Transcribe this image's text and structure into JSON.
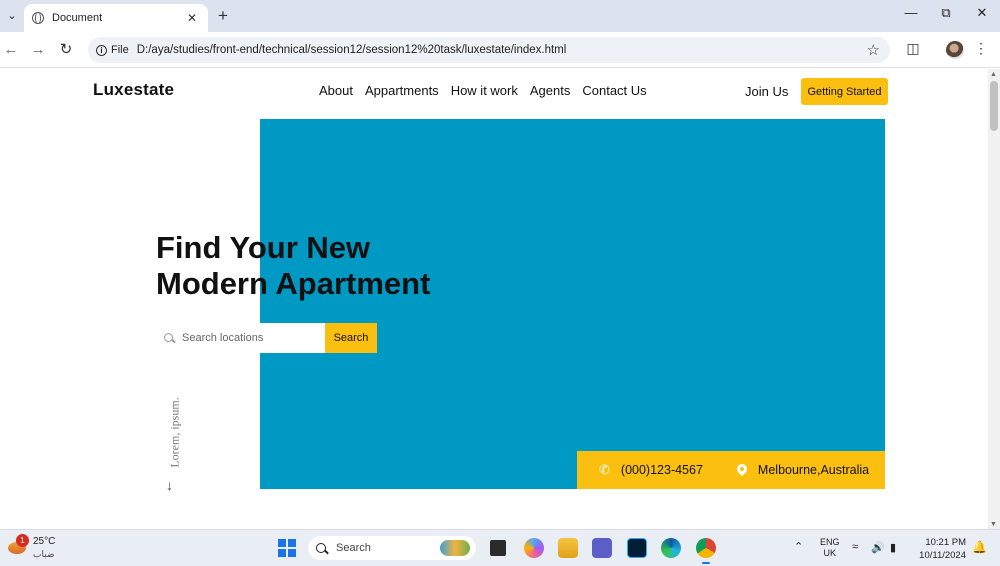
{
  "browser": {
    "tab_title": "Document",
    "new_tab_symbol": "+",
    "url_scheme_label": "File",
    "url": "D:/aya/studies/front-end/technical/session12/session12%20task/luxestate/index.html"
  },
  "site": {
    "logo": "Luxestate",
    "nav": [
      "About",
      "Appartments",
      "How it work",
      "Agents",
      "Contact Us"
    ],
    "join_label": "Join Us",
    "cta_label": "Getting Started",
    "headline_line1": "Find Your New",
    "headline_line2": "Modern Apartment",
    "search_placeholder": "Search locations",
    "search_button": "Search",
    "vertical_text": "Lorem, ipsum.",
    "phone": "(000)123-4567",
    "location": "Melbourne,Australia",
    "colors": {
      "accent": "#fbbf10",
      "hero": "#0099c4"
    }
  },
  "taskbar": {
    "weather_badge": "1",
    "temperature": "25°C",
    "weather_condition": "ضباب",
    "search_label": "Search",
    "lang_line1": "ENG",
    "lang_line2": "UK",
    "time": "10:21 PM",
    "date": "10/11/2024"
  }
}
